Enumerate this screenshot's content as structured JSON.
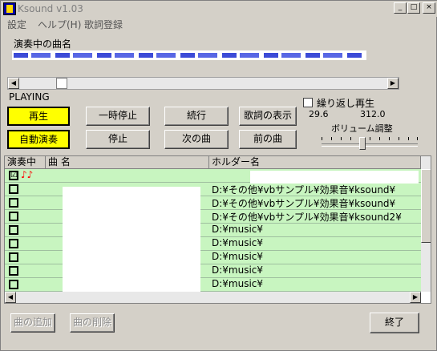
{
  "window": {
    "title": "Ksound v1.03",
    "minimize": "_",
    "maximize": "□",
    "close": "×"
  },
  "menu": [
    "設定",
    "ヘルプ(H)",
    "歌詞登録"
  ],
  "now_playing": {
    "label": "演奏中の曲名",
    "status": "PLAYING"
  },
  "buttons": {
    "play": "再生",
    "pause": "一時停止",
    "resume": "続行",
    "show_lyrics": "歌詞の表示",
    "auto_play": "自動演奏",
    "stop": "停止",
    "next": "次の曲",
    "prev": "前の曲",
    "add_song": "曲の追加",
    "delete_song": "曲の削除",
    "exit": "終了"
  },
  "repeat": {
    "label": "繰り返し再生",
    "checked": false
  },
  "time": {
    "current": "29.6",
    "total": "312.0"
  },
  "volume": {
    "label": "ボリューム調整",
    "level": 0.45
  },
  "table": {
    "columns": [
      "演奏中",
      "曲 名",
      "ホルダー名"
    ],
    "rows": [
      {
        "checked": "☑",
        "playing": "♪♪",
        "path": ""
      },
      {
        "checked": "",
        "playing": "",
        "path": "D:¥その他¥vbサンプル¥効果音¥ksound¥"
      },
      {
        "checked": "",
        "playing": "",
        "path": "D:¥その他¥vbサンプル¥効果音¥ksound¥"
      },
      {
        "checked": "",
        "playing": "",
        "path": "D:¥その他¥vbサンプル¥効果音¥ksound2¥"
      },
      {
        "checked": "",
        "playing": "",
        "path": "D:¥music¥"
      },
      {
        "checked": "",
        "playing": "",
        "path": "D:¥music¥"
      },
      {
        "checked": "",
        "playing": "",
        "path": "D:¥music¥"
      },
      {
        "checked": "",
        "playing": "",
        "path": "D:¥music¥"
      },
      {
        "checked": "",
        "playing": "",
        "path": "D:¥music¥"
      }
    ]
  },
  "colors": {
    "accent_button": "#ffff00",
    "row_background": "#c8f5c0",
    "now_playing_text": "#1a2bd0"
  }
}
